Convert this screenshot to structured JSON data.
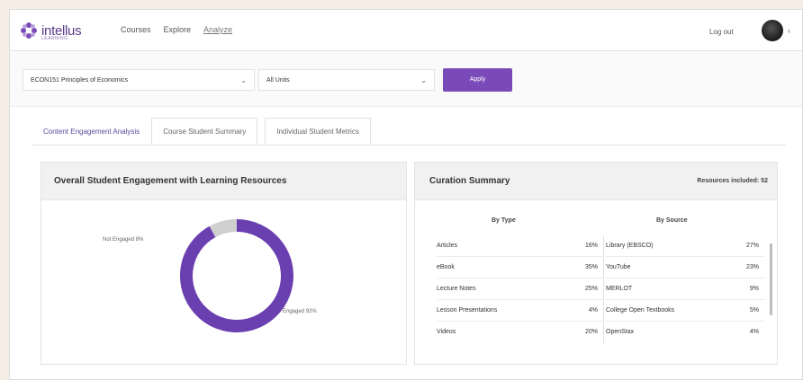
{
  "brand": {
    "name": "intellus",
    "sub": "LEARNING"
  },
  "nav": {
    "links": [
      "Courses",
      "Explore",
      "Analyze"
    ],
    "logout": "Log out",
    "caret": "‹"
  },
  "filters": {
    "course": "ECON151 Principles of Economics",
    "units": "All Units",
    "apply": "Apply",
    "caret": "⌄"
  },
  "tabs": [
    "Content Engagement Analysis",
    "Course Student Summary",
    "Individual Student Metrics"
  ],
  "engagement": {
    "title": "Overall Student Engagement with Learning Resources",
    "not_engaged_label": "Not Engaged 8%",
    "engaged_label": "Engaged 92%",
    "not_engaged_fraction": 0.08,
    "colors": {
      "engaged": "#6a3fb0",
      "not_engaged": "#cfcfcf"
    }
  },
  "curation": {
    "title": "Curation Summary",
    "resources_included": "Resources included: 52",
    "by_type_header": "By Type",
    "by_source_header": "By Source",
    "by_type": [
      {
        "label": "Articles",
        "value": "16%"
      },
      {
        "label": "eBook",
        "value": "35%"
      },
      {
        "label": "Lecture Notes",
        "value": "25%"
      },
      {
        "label": "Lesson Presentations",
        "value": "4%"
      },
      {
        "label": "Videos",
        "value": "20%"
      }
    ],
    "by_source": [
      {
        "label": "Library (EBSCO)",
        "value": "27%"
      },
      {
        "label": "YouTube",
        "value": "23%"
      },
      {
        "label": "MERLOT",
        "value": "9%"
      },
      {
        "label": "College Open Textbooks",
        "value": "5%"
      },
      {
        "label": "OpenStax",
        "value": "4%"
      }
    ]
  },
  "accent": "#7a4ab8"
}
